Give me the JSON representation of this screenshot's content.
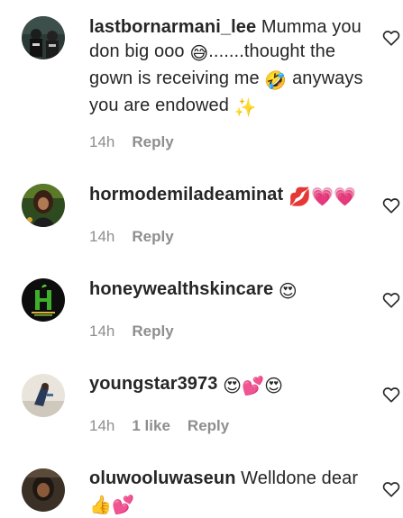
{
  "comments": [
    {
      "username": "lastbornarmani_lee",
      "text_1": " Mumma you don big ooo ",
      "emoji_1": "😅",
      "text_2": ".......thought the gown is receiving me ",
      "emoji_2": "🤣",
      "text_3": " anyways you are endowed ",
      "emoji_3": "✨",
      "time": "14h",
      "reply": "Reply"
    },
    {
      "username": "hormodemiladeaminat",
      "text_1": " ",
      "emojis": "💋💗💗",
      "time": "14h",
      "reply": "Reply"
    },
    {
      "username": "honeywealthskincare",
      "text_1": " ",
      "emojis": "😍",
      "time": "14h",
      "reply": "Reply"
    },
    {
      "username": "youngstar3973",
      "text_1": " ",
      "emojis": "😍💕😍",
      "time": "14h",
      "likes": "1 like",
      "reply": "Reply"
    },
    {
      "username": "oluwooluwaseun",
      "text_1": " Welldone dear ",
      "emojis": "👍💕"
    }
  ],
  "colors": {
    "text": "#262626",
    "meta": "#8e8e8e",
    "background": "#ffffff"
  },
  "icons": {
    "like": "heart-outline-icon"
  }
}
